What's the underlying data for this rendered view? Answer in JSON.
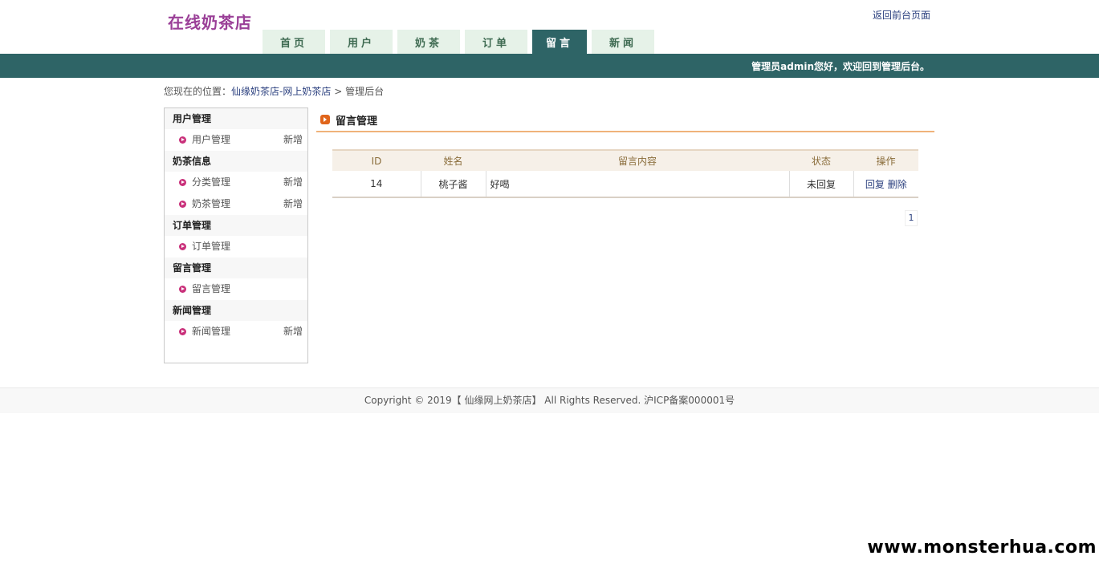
{
  "header": {
    "site_title": "在线奶茶店",
    "back_link": "返回前台页面"
  },
  "nav": {
    "tabs": [
      {
        "label": "首页",
        "active": false
      },
      {
        "label": "用户",
        "active": false
      },
      {
        "label": "奶茶",
        "active": false
      },
      {
        "label": "订单",
        "active": false
      },
      {
        "label": "留言",
        "active": true
      },
      {
        "label": "新闻",
        "active": false
      }
    ]
  },
  "banner": {
    "welcome": "管理员admin您好，欢迎回到管理后台。"
  },
  "breadcrumb": {
    "prefix": "您现在的位置：",
    "link": "仙缘奶茶店-网上奶茶店",
    "separator": ">",
    "current": "管理后台"
  },
  "sidebar": {
    "groups": [
      {
        "title": "用户管理",
        "items": [
          {
            "label": "用户管理",
            "add": "新增"
          }
        ]
      },
      {
        "title": "奶茶信息",
        "items": [
          {
            "label": "分类管理",
            "add": "新增"
          },
          {
            "label": "奶茶管理",
            "add": "新增"
          }
        ]
      },
      {
        "title": "订单管理",
        "items": [
          {
            "label": "订单管理",
            "add": ""
          }
        ]
      },
      {
        "title": "留言管理",
        "items": [
          {
            "label": "留言管理",
            "add": ""
          }
        ]
      },
      {
        "title": "新闻管理",
        "items": [
          {
            "label": "新闻管理",
            "add": "新增"
          }
        ]
      }
    ]
  },
  "panel": {
    "title": "留言管理"
  },
  "table": {
    "headers": [
      "ID",
      "姓名",
      "留言内容",
      "状态",
      "操作"
    ],
    "rows": [
      {
        "id": "14",
        "name": "桃子酱",
        "content": "好喝",
        "status": "未回复",
        "reply": "回复",
        "delete": "删除"
      }
    ]
  },
  "pager": {
    "current": "1"
  },
  "footer": {
    "copyright": "Copyright © 2019【 仙缘网上奶茶店】 All Rights Reserved. 沪ICP备案000001号"
  },
  "watermark": "www.monsterhua.com",
  "colors": {
    "banner": "#2e6466",
    "title": "#9a3f97",
    "accent_rule": "#f0b27a",
    "link": "#2a3f7e"
  }
}
